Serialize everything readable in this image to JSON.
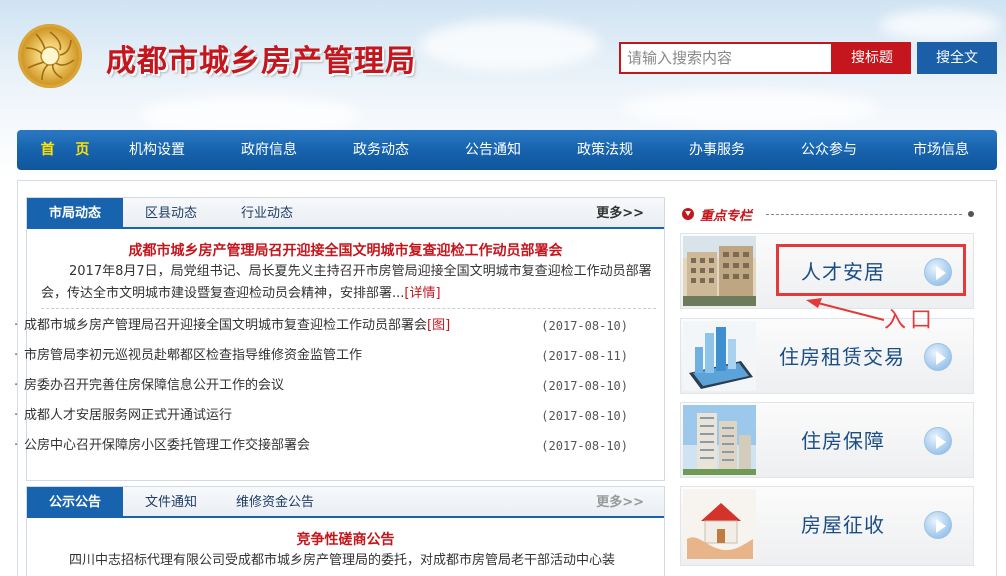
{
  "header": {
    "site_title": "成都市城乡房产管理局",
    "search_placeholder": "请输入搜索内容",
    "search_title_btn": "搜标题",
    "search_full_btn": "搜全文"
  },
  "nav": {
    "items": [
      "首 页",
      "机构设置",
      "政府信息",
      "政务动态",
      "公告通知",
      "政策法规",
      "办事服务",
      "公众参与",
      "市场信息"
    ]
  },
  "panel1": {
    "tabs": [
      "市局动态",
      "区县动态",
      "行业动态"
    ],
    "more": "更多>>",
    "headline": "成都市城乡房产管理局召开迎接全国文明城市复查迎检工作动员部署会",
    "summary": "2017年8月7日，局党组书记、局长夏先义主持召开市房管局迎接全国文明城市复查迎检工作动员部署会，传达全市文明城市建设暨复查迎检动员会精神，安排部署...",
    "detail_link": "[详情]",
    "news": [
      {
        "title": "成都市城乡房产管理局召开迎接全国文明城市复查迎检工作动员部署会",
        "pic": "[图]",
        "date": "(2017-08-10)"
      },
      {
        "title": "市房管局李初元巡视员赴郫都区检查指导维修资金监管工作",
        "pic": "",
        "date": "(2017-08-11)"
      },
      {
        "title": "房委办召开完善住房保障信息公开工作的会议",
        "pic": "",
        "date": "(2017-08-10)"
      },
      {
        "title": "成都人才安居服务网正式开通试运行",
        "pic": "",
        "date": "(2017-08-10)"
      },
      {
        "title": "公房中心召开保障房小区委托管理工作交接部署会",
        "pic": "",
        "date": "(2017-08-10)"
      }
    ]
  },
  "panel2": {
    "tabs": [
      "公示公告",
      "文件通知",
      "维修资金公告"
    ],
    "more": "更多>>",
    "headline": "竞争性磋商公告",
    "summary": "四川中志招标代理有限公司受成都市城乡房产管理局的委托，对成都市房管局老干部活动中心装"
  },
  "sidebar": {
    "heading": "重点专栏",
    "items": [
      "人才安居",
      "住房租赁交易",
      "住房保障",
      "房屋征收"
    ]
  },
  "annotation": {
    "entry_label": "入口"
  },
  "colors": {
    "brand_red": "#c4161c",
    "nav_blue": "#1763ad",
    "annotation_red": "#e23a3a"
  }
}
